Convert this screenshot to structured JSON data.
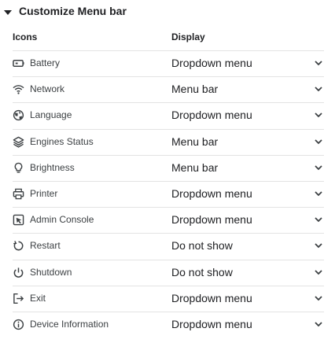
{
  "section": {
    "title": "Customize Menu bar",
    "collapse_icon": "caret-down-icon"
  },
  "columns": {
    "icons": "Icons",
    "display": "Display"
  },
  "rows": [
    {
      "icon": "battery-icon",
      "label": "Battery",
      "display": "Dropdown menu"
    },
    {
      "icon": "wifi-icon",
      "label": "Network",
      "display": "Menu bar"
    },
    {
      "icon": "globe-icon",
      "label": "Language",
      "display": "Dropdown menu"
    },
    {
      "icon": "layers-icon",
      "label": "Engines Status",
      "display": "Menu bar"
    },
    {
      "icon": "lightbulb-icon",
      "label": "Brightness",
      "display": "Menu bar"
    },
    {
      "icon": "printer-icon",
      "label": "Printer",
      "display": "Dropdown menu"
    },
    {
      "icon": "admin-console-icon",
      "label": "Admin Console",
      "display": "Dropdown menu"
    },
    {
      "icon": "restart-icon",
      "label": "Restart",
      "display": "Do not show"
    },
    {
      "icon": "power-icon",
      "label": "Shutdown",
      "display": "Do not show"
    },
    {
      "icon": "exit-icon",
      "label": "Exit",
      "display": "Dropdown menu"
    },
    {
      "icon": "info-icon",
      "label": "Device Information",
      "display": "Dropdown menu"
    }
  ]
}
